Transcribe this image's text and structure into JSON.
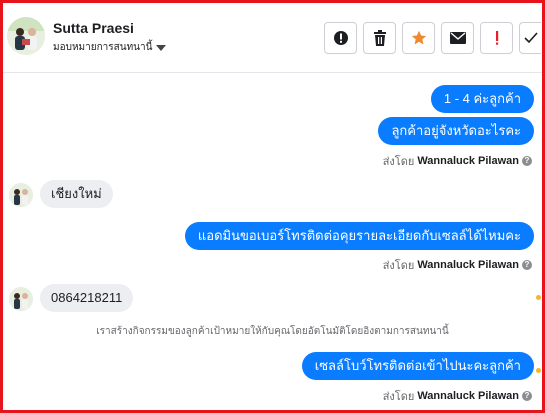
{
  "header": {
    "contact_name": "Sutta Praesi",
    "assign_label": "มอบหมายการสนทนานี้",
    "toolbar": [
      {
        "name": "spam-alert-button",
        "icon": "alert-circle-icon"
      },
      {
        "name": "delete-button",
        "icon": "trash-icon"
      },
      {
        "name": "star-button",
        "icon": "star-icon"
      },
      {
        "name": "mark-unread-button",
        "icon": "envelope-icon"
      },
      {
        "name": "follow-up-button",
        "icon": "exclamation-icon"
      },
      {
        "name": "done-button",
        "icon": "check-icon"
      }
    ]
  },
  "colors": {
    "outgoing_bubble": "#0a7cff",
    "incoming_bubble": "#eceef1",
    "star": "#f0892e",
    "exclaim": "#e4212a",
    "frame": "#e8141b"
  },
  "messages": {
    "m1": "1 - 4  ค่ะลูกค้า",
    "m2": "ลูกค้าอยู่จังหวัดอะไรคะ",
    "m3": "เชียงใหม่",
    "m4": "แอดมินขอเบอร์โทรติดต่อคุยรายละเอียดกับเซลล์ได้ไหมคะ",
    "m5": "0864218211",
    "m6": "เซลล์โบว์โทรติดต่อเข้าไปนะคะลูกค้า"
  },
  "sent_by": {
    "prefix": "ส่งโดย",
    "agent": "Wannaluck Pilawan"
  },
  "system_note": "เราสร้างกิจกรรมของลูกค้าเป้าหมายให้กับคุณโดยอัตโนมัติโดยอิงตามการสนทนานี้"
}
